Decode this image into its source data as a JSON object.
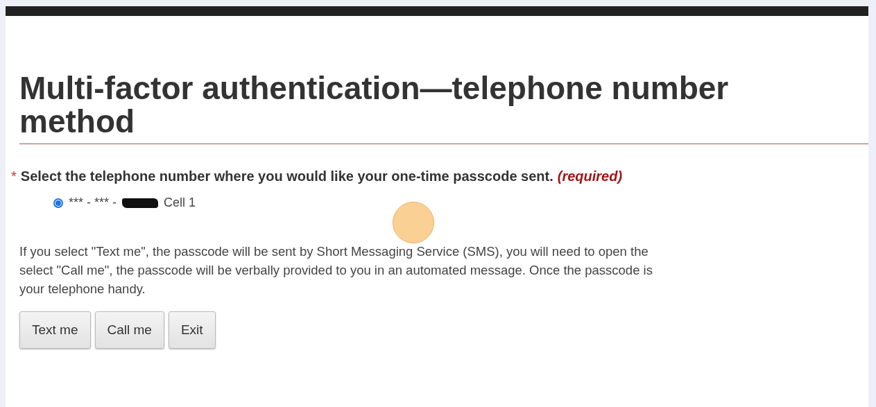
{
  "heading_lines": [
    "Multi-factor authentication—telephone number",
    "method"
  ],
  "question": {
    "required_mark": "*",
    "label": "Select the telephone number where you would like your one-time passcode sent.",
    "note": "(required)"
  },
  "phone_options": [
    {
      "masked": "*** - *** -",
      "redacted": true,
      "label": "Cell 1",
      "selected": true
    }
  ],
  "info_lines": [
    "If you select \"Text me\", the passcode will be sent by Short Messaging Service (SMS), you will need to open the",
    "select \"Call me\", the passcode will be verbally provided to you in an automated message. Once the passcode is",
    "your telephone handy."
  ],
  "buttons": [
    "Text me",
    "Call me",
    "Exit"
  ],
  "click_indicator": {
    "shown": true
  }
}
